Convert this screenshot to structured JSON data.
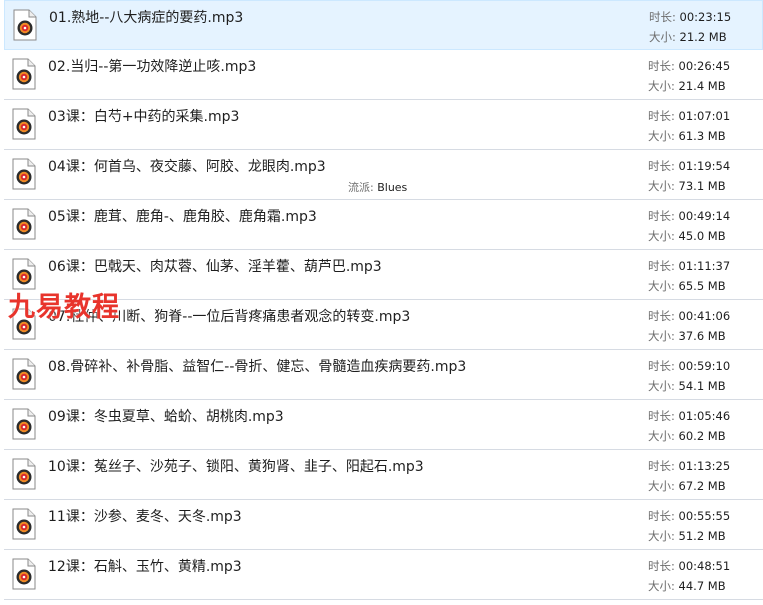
{
  "labels": {
    "duration": "时长:",
    "size": "大小:",
    "genre": "流派:"
  },
  "files": [
    {
      "name": "01.熟地--八大病症的要药.mp3",
      "duration": "00:23:15",
      "size": "21.2 MB",
      "selected": true
    },
    {
      "name": "02.当归--第一功效降逆止咳.mp3",
      "duration": "00:26:45",
      "size": "21.4 MB"
    },
    {
      "name": "03课：白芍+中药的采集.mp3",
      "duration": "01:07:01",
      "size": "61.3 MB"
    },
    {
      "name": "04课：何首乌、夜交藤、阿胶、龙眼肉.mp3",
      "duration": "01:19:54",
      "size": "73.1 MB",
      "genre": "Blues"
    },
    {
      "name": "05课：鹿茸、鹿角-、鹿角胶、鹿角霜.mp3",
      "duration": "00:49:14",
      "size": "45.0 MB"
    },
    {
      "name": "06课：巴戟天、肉苁蓉、仙茅、淫羊藿、葫芦巴.mp3",
      "duration": "01:11:37",
      "size": "65.5 MB"
    },
    {
      "name": "07.杜仲、川断、狗脊--一位后背疼痛患者观念的转变.mp3",
      "duration": "00:41:06",
      "size": "37.6 MB"
    },
    {
      "name": "08.骨碎补、补骨脂、益智仁--骨折、健忘、骨髓造血疾病要药.mp3",
      "duration": "00:59:10",
      "size": "54.1 MB"
    },
    {
      "name": "09课：冬虫夏草、蛤蚧、胡桃肉.mp3",
      "duration": "01:05:46",
      "size": "60.2 MB"
    },
    {
      "name": "10课：菟丝子、沙苑子、锁阳、黄狗肾、韭子、阳起石.mp3",
      "duration": "01:13:25",
      "size": "67.2 MB"
    },
    {
      "name": "11课：沙参、麦冬、天冬.mp3",
      "duration": "00:55:55",
      "size": "51.2 MB"
    },
    {
      "name": "12课：石斛、玉竹、黄精.mp3",
      "duration": "00:48:51",
      "size": "44.7 MB"
    }
  ],
  "watermark": "九易教程",
  "colors": {
    "selected_bg": "#e5f3ff",
    "watermark": "#e8342c",
    "divider": "#d6dbe3"
  },
  "icon": "audio-file-icon"
}
